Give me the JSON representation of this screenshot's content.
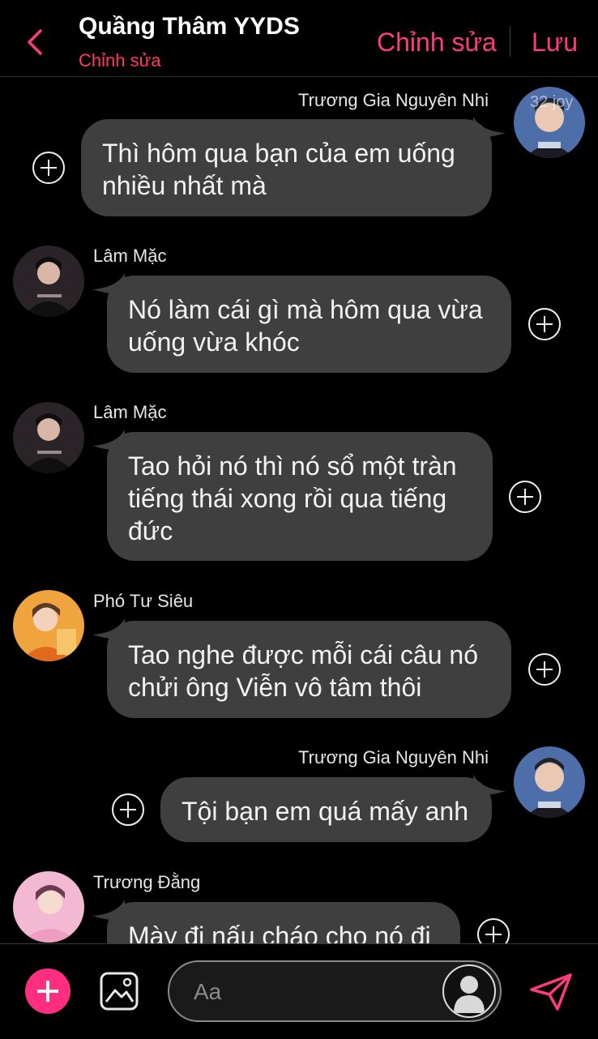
{
  "header": {
    "title": "Quầng Thâm YYDS",
    "subtitle": "Chỉnh sửa",
    "edit_label": "Chỉnh sửa",
    "save_label": "Lưu"
  },
  "messages": [
    {
      "sender": "Trương Gia Nguyên Nhi",
      "lines": [
        "Thì hôm qua bạn của em uống",
        "nhiều nhất mà"
      ],
      "side": "right",
      "avatar_badge": "32 joy"
    },
    {
      "sender": "Lâm Mặc",
      "lines": [
        "Nó làm cái gì mà hôm qua vừa",
        "uống vừa khóc"
      ],
      "side": "left"
    },
    {
      "sender": "Lâm Mặc",
      "lines": [
        "Tao hỏi nó thì nó sổ một tràn",
        "tiếng thái xong rồi qua tiếng",
        "đức"
      ],
      "side": "left"
    },
    {
      "sender": "Phó Tư Siêu",
      "lines": [
        "Tao nghe được mỗi cái câu nó",
        "chửi ông Viễn vô tâm thôi"
      ],
      "side": "left"
    },
    {
      "sender": "Trương Gia Nguyên Nhi",
      "lines": [
        "Tội bạn em quá mấy anh"
      ],
      "side": "right"
    },
    {
      "sender": "Trương Đằng",
      "lines": [
        "Mày đi nấu cháo cho nó đi"
      ],
      "side": "left"
    }
  ],
  "composer": {
    "placeholder": "Aa"
  },
  "colors": {
    "accent": "#ff3b7f",
    "subtitle": "#ff3b5c",
    "bubble": "#3f3f3f",
    "background": "#000000"
  },
  "icons": [
    "chevron-left-icon",
    "plus-circle-icon",
    "image-icon",
    "profile-silhouette-icon",
    "send-icon"
  ]
}
